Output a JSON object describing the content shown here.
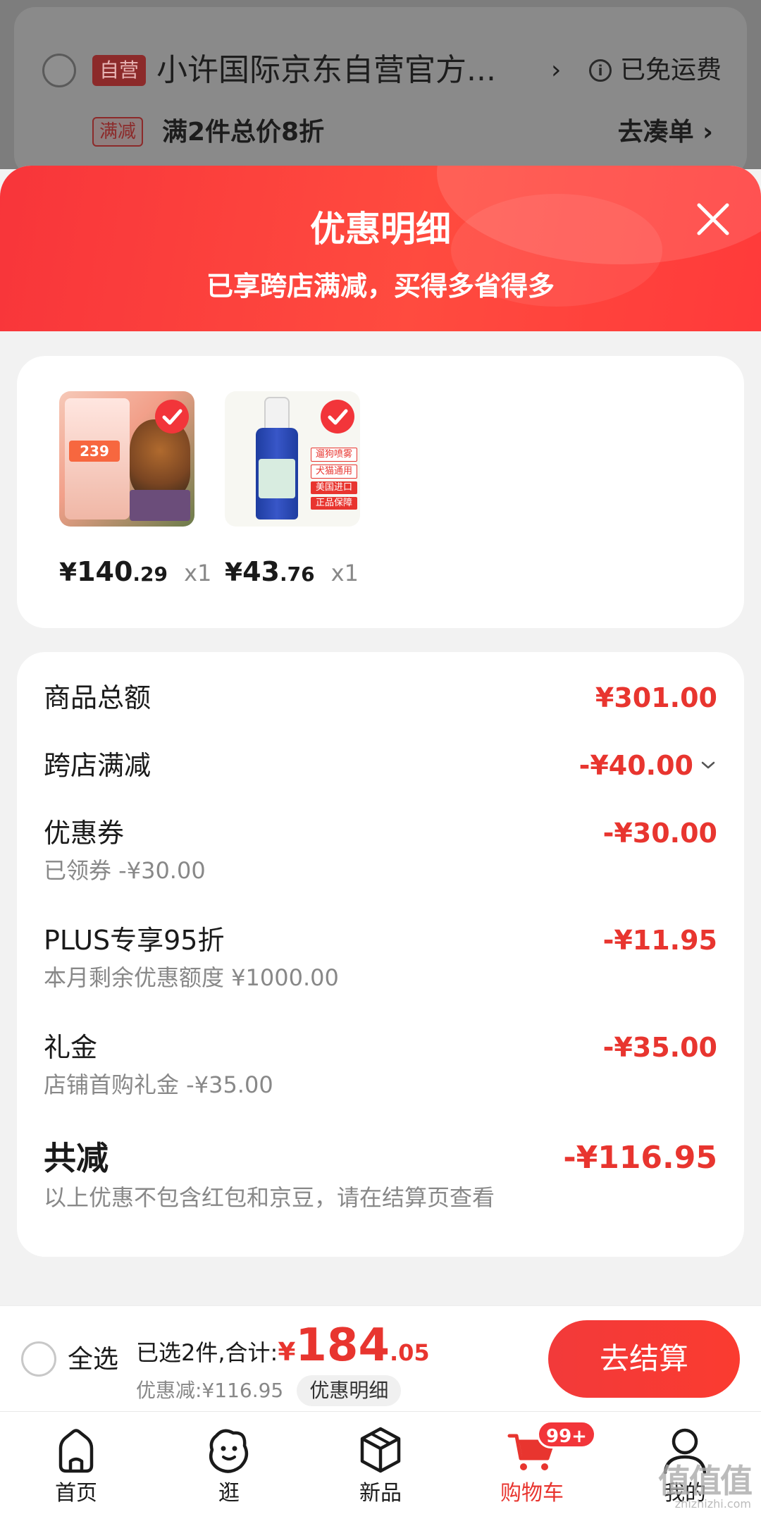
{
  "background_cart": {
    "self_tag": "自营",
    "store_name": "小许国际京东自营官方...",
    "chevron": "›",
    "free_shipping": "已免运费",
    "promo_tag": "满减",
    "promo_text": "满2件总价8折",
    "goto_label": "去凑单 ›"
  },
  "sheet": {
    "title": "优惠明细",
    "subtitle": "已享跨店满减，买得多省得多",
    "close_icon": "close-icon"
  },
  "products": [
    {
      "yen": "¥",
      "price_int": "140",
      "price_dec": ".29",
      "qty": "x1",
      "image": "dog-food-bag",
      "checked": true
    },
    {
      "yen": "¥",
      "price_int": "43",
      "price_dec": ".76",
      "qty": "x1",
      "image": "spray-bottle",
      "checked": true
    }
  ],
  "product_image_text": {
    "food_price_tag": "239",
    "spray_tags": [
      "遛狗喷雾",
      "犬猫通用",
      "美国进口",
      "正品保障"
    ]
  },
  "summary": {
    "goods_total": {
      "label": "商品总额",
      "amount": "¥301.00"
    },
    "cross_store": {
      "label": "跨店满减",
      "amount": "-¥40.00"
    },
    "coupon": {
      "label": "优惠券",
      "sub": "已领券 -¥30.00",
      "amount": "-¥30.00"
    },
    "plus": {
      "label": "PLUS专享95折",
      "sub": "本月剩余优惠额度 ¥1000.00",
      "amount": "-¥11.95"
    },
    "gift": {
      "label": "礼金",
      "sub": "店铺首购礼金 -¥35.00",
      "amount": "-¥35.00"
    },
    "total": {
      "label": "共减",
      "sub": "以上优惠不包含红包和京豆，请在结算页查看",
      "amount": "-¥116.95"
    }
  },
  "checkout": {
    "select_all": "全选",
    "selected_text": "已选2件,合计:",
    "total_yen": "¥",
    "total_int": "184",
    "total_dec": ".05",
    "discount_text": "优惠减:¥116.95",
    "detail_pill": "优惠明细",
    "checkout_button": "去结算"
  },
  "tabbar": {
    "tabs": [
      {
        "label": "首页",
        "icon": "home-icon"
      },
      {
        "label": "逛",
        "icon": "browse-icon"
      },
      {
        "label": "新品",
        "icon": "new-products-icon"
      },
      {
        "label": "购物车",
        "icon": "cart-icon",
        "badge": "99+",
        "active": true
      },
      {
        "label": "我的",
        "icon": "profile-icon"
      }
    ]
  },
  "watermark": {
    "big": "值值值",
    "small": "zhizhizhi.com"
  },
  "colors": {
    "accent": "#e8352f",
    "header_red": "#f8353a",
    "overlay_gray": "#7d7d7d"
  }
}
